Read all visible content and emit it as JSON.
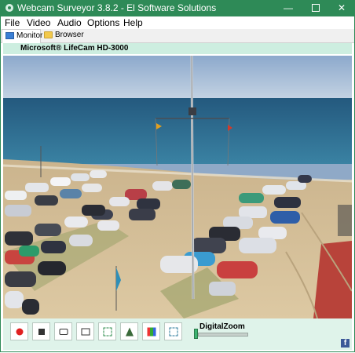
{
  "window": {
    "title": "Webcam Surveyor 3.8.2 - El Software Solutions",
    "controls": {
      "minimize": "—",
      "close": "✕"
    }
  },
  "menu": {
    "items": [
      "File",
      "Video",
      "Audio",
      "Options",
      "Help"
    ]
  },
  "tabs": [
    {
      "label": "Monitor",
      "icon": "monitor-icon",
      "active": true
    },
    {
      "label": "Browser",
      "icon": "folder-icon",
      "active": false
    }
  ],
  "camera": {
    "name": "Microsoft® LifeCam HD-3000",
    "scene": "beach-with-jet-skis"
  },
  "controls": {
    "buttons": [
      {
        "name": "record-button",
        "icon": "record-icon"
      },
      {
        "name": "stop-button",
        "icon": "stop-icon"
      },
      {
        "name": "snapshot-button",
        "icon": "camera-icon"
      },
      {
        "name": "video-capture-button",
        "icon": "video-icon"
      },
      {
        "name": "motion-detection-button",
        "icon": "motion-icon"
      },
      {
        "name": "broadcast-button",
        "icon": "tower-icon"
      },
      {
        "name": "color-settings-button",
        "icon": "color-icon"
      },
      {
        "name": "fullscreen-button",
        "icon": "fullscreen-icon"
      }
    ],
    "zoom_label": "DigitalZoom",
    "zoom_value": 0.0
  },
  "social": {
    "facebook_label": "f"
  },
  "colors": {
    "titlebar": "#2e8a57",
    "camera_bar": "#cdeee0",
    "control_panel": "#dff3ea",
    "sea": "#2f6f95",
    "sky": "#a9c1db",
    "sand": "#d8c29a"
  }
}
